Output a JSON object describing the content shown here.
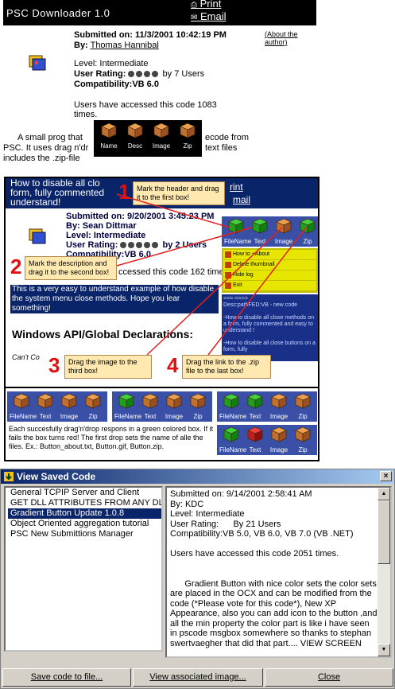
{
  "top": {
    "title": "PSC Downloader 1.0",
    "print": "Print",
    "email": "Email",
    "submitted": "Submitted on: 11/3/2001 10:42:19 PM",
    "by_label": "By:",
    "author": "Thomas Hannibal",
    "about": "(About the author)",
    "level": "Level: Intermediate",
    "rating_label": "User Rating:",
    "rating_suffix": "by 7 Users",
    "compat": "Compatibility:VB 6.0",
    "accessed": "Users have accessed this code 1083 times.",
    "desc_a": "A small prog that",
    "desc_b": "ecode from",
    "desc_c": "PSC. It uses drag n'dr",
    "desc_d": "text files",
    "desc_e": "includes the .zip-file",
    "popup": [
      "Name",
      "Desc",
      "Image",
      "Zip"
    ]
  },
  "tutorial": {
    "title_l1": "How to disable all clo",
    "title_l2": "form, fully commented",
    "title_l3": "understand!",
    "print": "rint",
    "email": "mail",
    "submitted": "Submitted on: 9/20/2001 3:45:23 PM",
    "by": "By: Sean Dittmar",
    "level": "Level: Intermediate",
    "rating_label": "User Rating:",
    "rating_suffix": "by 2 Users",
    "compat": "Compatibility:VB 6.0",
    "accessed": "ccessed this code 162 time",
    "desc": "This is a very easy to understand example of how disable the system menu close methods. Hope you lear something!",
    "section": "Windows API/Global Declarations:",
    "cant": "Can't Co",
    "callouts": {
      "c1": "Mark the header and drag it to the first box!",
      "c2": "Mark the description and drag it to the second box!",
      "c3": "Drag the image to the third box!",
      "c4": "Drag the link to the .zip file to the last box!"
    },
    "numbers": [
      "1",
      "2",
      "3",
      "4"
    ],
    "box_labels": [
      "FileName",
      "Text",
      "Image",
      "Zip"
    ],
    "menu": [
      "How to +About",
      "Delete thumbnail",
      "Hide log",
      "Exit"
    ],
    "log": "===-==>>\nDesc:pathFED:VB - new code\n\n-How to disable all close methods on a form, fully commented and easy to understand !\n\n-How to disable all close buttons on a form, fully",
    "note": "Each succesfully drag'n'drop respons in a green colored box. If it fails the box turns red! The first drop sets the name of alle the files. Ex.: Button_about.txt, Button.gif, Button.zip."
  },
  "dialog": {
    "title": "View Saved Code",
    "list": [
      "General TCPIP Server and Client",
      "GET DLL ATTRIBUTES FROM ANY DLL",
      "Gradient Button Update 1.0.8",
      "Object Oriented aggregation tutorial",
      "PSC New Submittions Manager"
    ],
    "selected_index": 2,
    "text": "Submitted on: 9/14/2001 2:58:41 AM\nBy: KDC\nLevel: Intermediate\nUser Rating:      By 21 Users\nCompatibility:VB 5.0, VB 6.0, VB 7.0 (VB .NET)\n\nUsers have accessed this code 2051 times.\n\n\n      Gradient Button with nice color sets the color sets are placed in the OCX and can be modified from the code (*Please vote for this code*), New XP Appearance, also you can add icon to the button ,and all the min property the color part is like i have seen in pscode msgbox somewhere so thanks to stephan swertvaegher that did that part.... VIEW SCREEN",
    "buttons": {
      "save": "Save code to file...",
      "view": "View associated image...",
      "close": "Close"
    }
  }
}
